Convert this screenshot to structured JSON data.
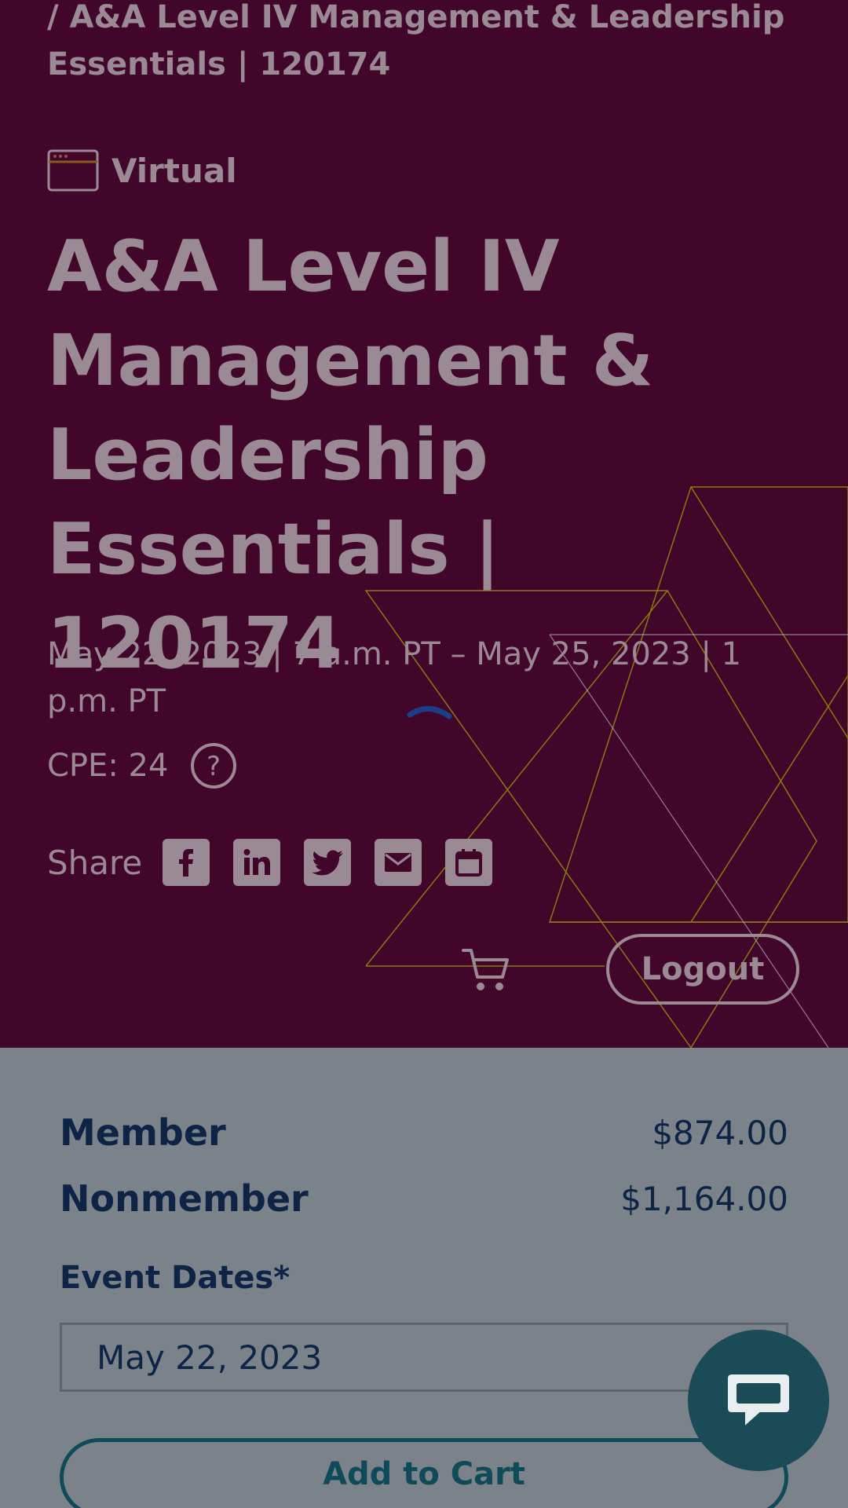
{
  "breadcrumb": "/ A&A Level IV Management & Leadership Essentials | 120174",
  "event": {
    "format": "Virtual",
    "title": "A&A Level IV Management & Leadership Essentials | 120174",
    "dates": "May 22, 2023 | 7 a.m. PT – May 25, 2023 | 1 p.m. PT",
    "cpe": "CPE: 24"
  },
  "share": {
    "label": "Share",
    "icons": [
      "facebook-icon",
      "linkedin-icon",
      "twitter-icon",
      "email-icon",
      "calendar-icon"
    ]
  },
  "header": {
    "logout_label": "Logout",
    "cart_icon": "cart-icon"
  },
  "pricing": [
    {
      "name": "Member",
      "price": "$874.00"
    },
    {
      "name": "Nonmember",
      "price": "$1,164.00"
    }
  ],
  "event_dates": {
    "label": "Event Dates*",
    "selected": "May 22, 2023"
  },
  "add_to_cart_label": "Add to Cart",
  "chat_icon": "chat-icon",
  "colors": {
    "hero_background": "#42062b",
    "overlay": "#7c8289",
    "heading_text": "#0d2447",
    "accent_teal": "#1a4b57",
    "pattern_gold": "#8a7a0e"
  }
}
